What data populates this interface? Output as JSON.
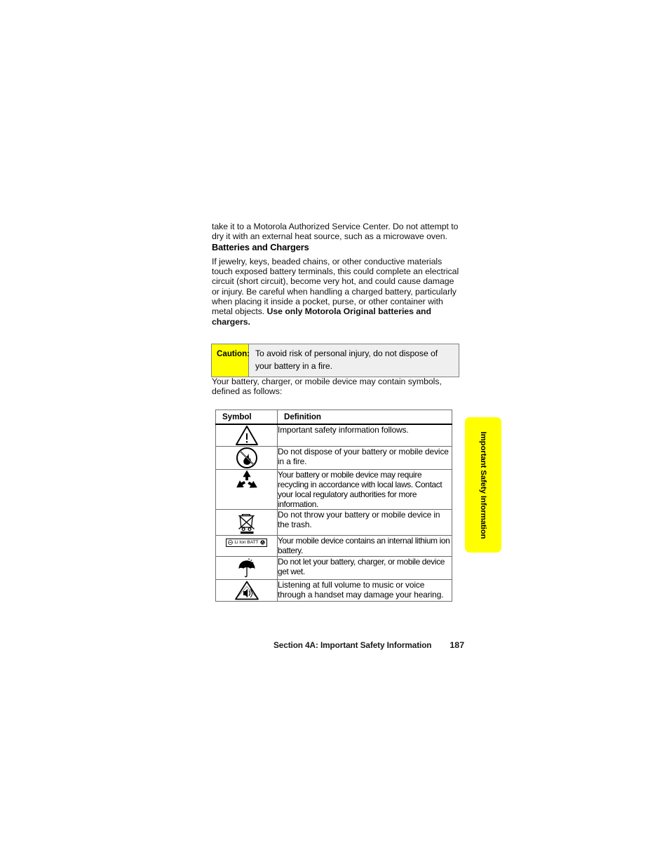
{
  "document": {
    "top_paragraph": "take it to a Motorola Authorized Service Center. Do not attempt to dry it with an external heat source, such as a microwave oven.",
    "section_heading": "Batteries and Chargers",
    "batteries_paragraph_plain": "If jewelry, keys, beaded chains, or other conductive materials touch exposed battery terminals, this could complete an electrical circuit (short circuit), become very hot, and could cause damage or injury. Be careful when handling a charged battery, particularly when placing it inside a pocket, purse, or other container with metal objects. ",
    "batteries_paragraph_bold": "Use only Motorola Original batteries and chargers.",
    "pre_table_paragraph": "Your battery, charger, or mobile device may contain symbols, defined as follows:"
  },
  "caution": {
    "label": "Caution:",
    "text": "To avoid risk of personal injury, do not dispose of your battery in a fire.",
    "label_bg": "#ffff00",
    "box_bg": "#efefef",
    "border_color": "#808080"
  },
  "symbols_table": {
    "headers": {
      "symbol": "Symbol",
      "definition": "Definition"
    },
    "rows": [
      {
        "icon": "warning-triangle-icon",
        "definition": "Important safety information follows."
      },
      {
        "icon": "no-fire-icon",
        "definition": "Do not dispose of your battery or mobile device in a fire."
      },
      {
        "icon": "recycle-icon",
        "definition": "Your battery or mobile device may require recycling in accordance with local laws. Contact your local regulatory authorities for more information."
      },
      {
        "icon": "crossed-out-wheelie-bin-icon",
        "definition": "Do not throw your battery or mobile device in the trash."
      },
      {
        "icon": "li-ion-battery-badge-icon",
        "definition": "Your mobile device contains an internal lithium ion battery."
      },
      {
        "icon": "keep-dry-umbrella-icon",
        "definition": "Do not let your battery, charger, or mobile device get wet."
      },
      {
        "icon": "hearing-damage-icon",
        "definition": "Listening at full volume to music or voice through a handset may damage your hearing."
      }
    ]
  },
  "li_ion_badge": {
    "text": "Li Ion BATT"
  },
  "side_tab": {
    "label": "Important Safety Information",
    "color": "#ffff00"
  },
  "footer": {
    "section": "Section 4A: Important Safety Information",
    "page_number": "187"
  }
}
